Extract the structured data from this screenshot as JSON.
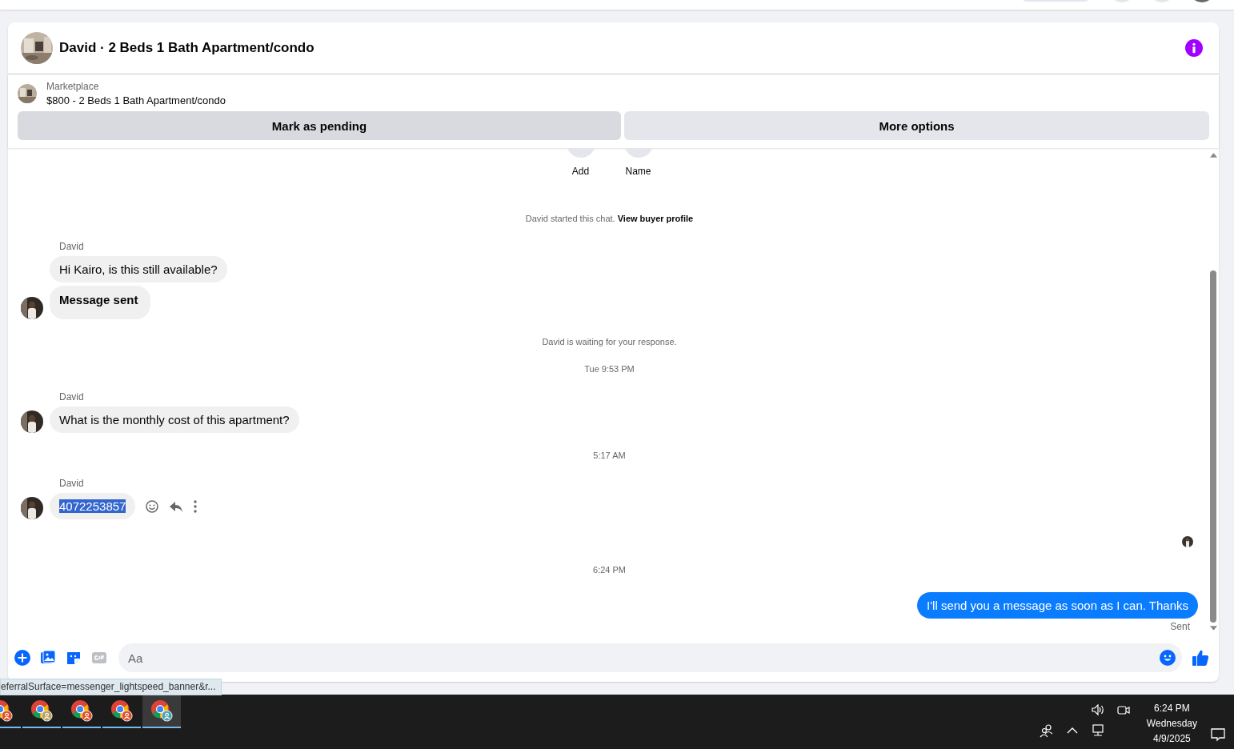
{
  "header": {
    "title": "David · 2 Beds 1 Bath Apartment/condo"
  },
  "listing": {
    "source": "Marketplace",
    "title": "$800 - 2 Beds 1 Bath Apartment/condo",
    "buttons": [
      "Mark as pending",
      "More options"
    ]
  },
  "quick_actions": [
    {
      "label": "Add"
    },
    {
      "label": "Name"
    }
  ],
  "messages": [
    {
      "kind": "system",
      "text": "David started this chat.",
      "link": "View buyer profile"
    },
    {
      "kind": "incoming",
      "sender": "David",
      "actions_visible": false,
      "bubbles": [
        {
          "text": "Hi Kairo, is this still available?",
          "bold": false,
          "selected": false
        },
        {
          "text": "Message sent",
          "bold": true,
          "selected": false
        }
      ]
    },
    {
      "kind": "system",
      "text": "David is waiting for your response."
    },
    {
      "kind": "timestamp",
      "text": "Tue 9:53 PM"
    },
    {
      "kind": "incoming",
      "sender": "David",
      "actions_visible": false,
      "bubbles": [
        {
          "text": "What is the monthly cost of this apartment?",
          "bold": false,
          "selected": false
        }
      ]
    },
    {
      "kind": "timestamp",
      "text": "5:17 AM"
    },
    {
      "kind": "incoming",
      "sender": "David",
      "actions_visible": true,
      "bubbles": [
        {
          "text": "4072253857",
          "bold": false,
          "selected": true
        }
      ]
    },
    {
      "kind": "seen"
    },
    {
      "kind": "timestamp",
      "text": "6:24 PM"
    },
    {
      "kind": "outgoing",
      "text": "I'll send you a message as soon as I can. Thanks",
      "status": "Sent"
    }
  ],
  "composer": {
    "placeholder": "Aa"
  },
  "status_url": "eferralSurface=messenger_lightspeed_banner&r...",
  "taskbar": {
    "apps": [
      {
        "color": "#e0502a",
        "selected": false
      },
      {
        "color": "#b5a35a",
        "selected": false
      },
      {
        "color": "#e0502a",
        "selected": false
      },
      {
        "color": "#e0502a",
        "selected": false
      },
      {
        "color": "#4aa3b5",
        "selected": true
      }
    ],
    "time": "6:24 PM",
    "day": "Wednesday",
    "date": "4/9/2025"
  }
}
